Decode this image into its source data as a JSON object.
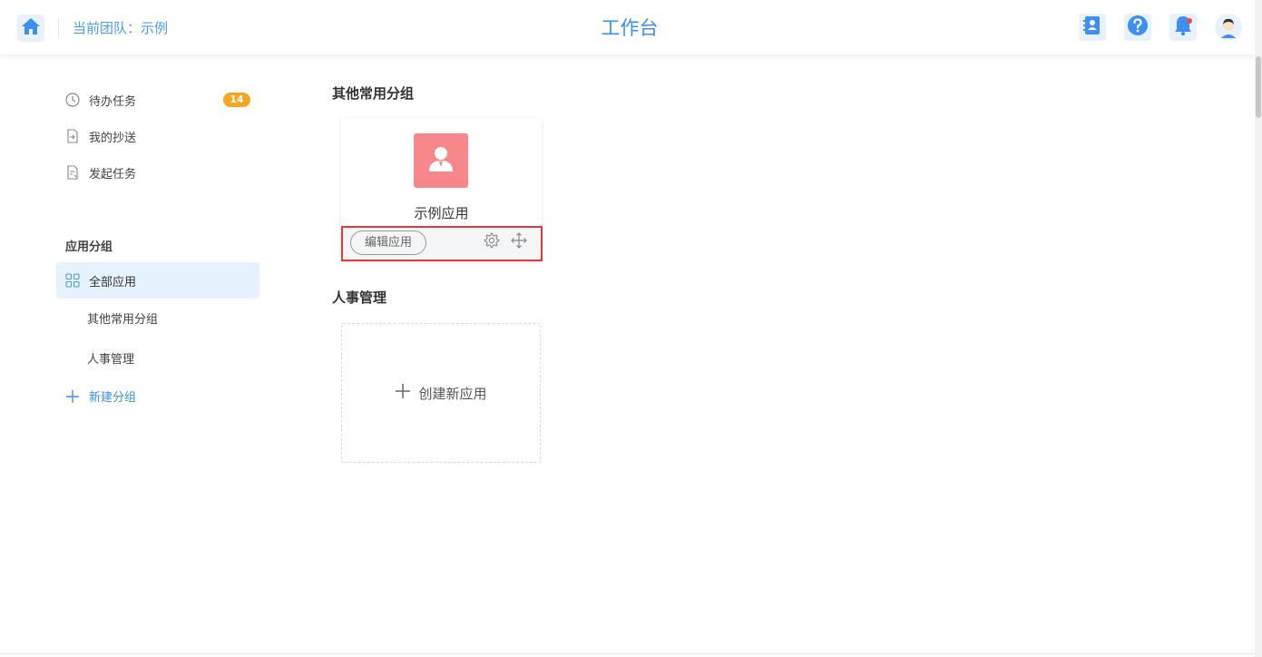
{
  "header": {
    "team_label": "当前团队：示例",
    "title": "工作台",
    "icons": [
      "home-icon",
      "contacts-icon",
      "help-icon",
      "bell-icon",
      "avatar"
    ]
  },
  "sidebar": {
    "items": [
      {
        "label": "待办任务",
        "icon": "clock-icon",
        "badge": "14"
      },
      {
        "label": "我的抄送",
        "icon": "file-forward-icon"
      },
      {
        "label": "发起任务",
        "icon": "file-edit-icon"
      }
    ],
    "group_heading": "应用分组",
    "all_apps": "全部应用",
    "groups": [
      "其他常用分组",
      "人事管理"
    ],
    "new_group": "新建分组"
  },
  "main": {
    "sections": [
      {
        "title": "其他常用分组",
        "apps": [
          {
            "name": "示例应用",
            "icon": "user-icon",
            "icon_color": "#f7878a",
            "edit_label": "编辑应用"
          }
        ]
      },
      {
        "title": "人事管理",
        "create_label": "创建新应用"
      }
    ]
  },
  "colors": {
    "accent": "#3d8ff0",
    "badge": "#f5a623",
    "highlight_border": "#e0393e",
    "active_bg": "#e6f2fd"
  }
}
